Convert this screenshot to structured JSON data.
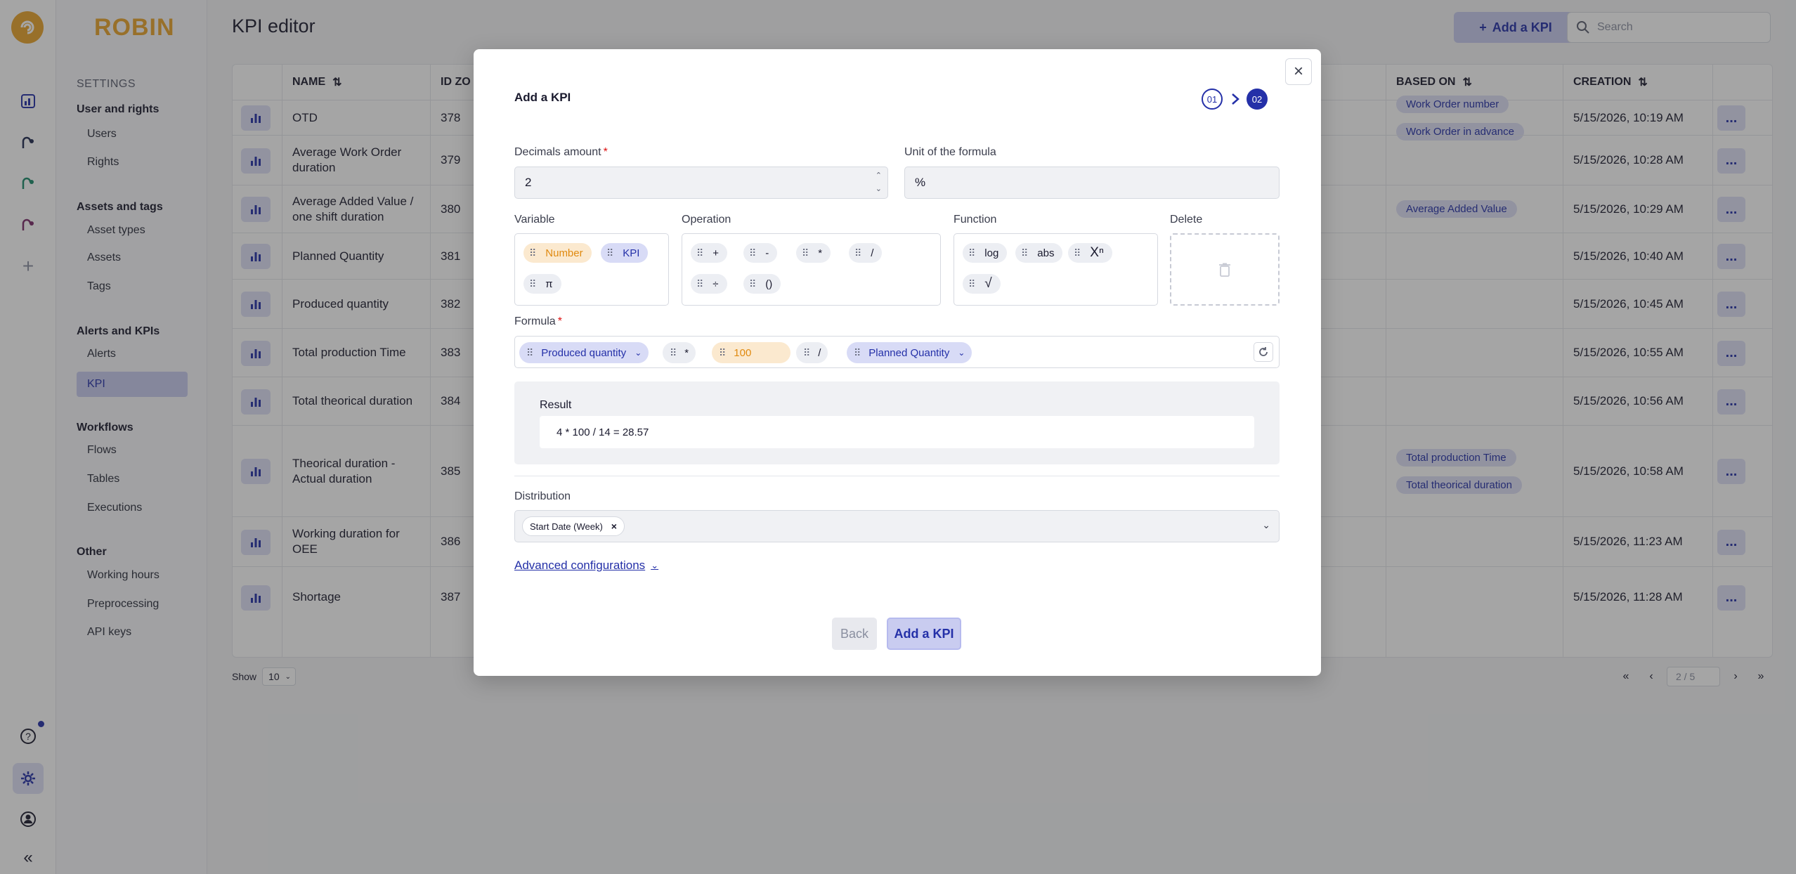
{
  "brand": {
    "name": "ROBIN"
  },
  "rail": {
    "notification_color": "#2430a8"
  },
  "sidebar": {
    "title": "SETTINGS",
    "groups": [
      {
        "label": "User and rights",
        "items": [
          "Users",
          "Rights"
        ]
      },
      {
        "label": "Assets and tags",
        "items": [
          "Asset types",
          "Assets",
          "Tags"
        ]
      },
      {
        "label": "Alerts and KPIs",
        "items": [
          "Alerts",
          "KPI"
        ]
      },
      {
        "label": "Workflows",
        "items": [
          "Flows",
          "Tables",
          "Executions"
        ]
      },
      {
        "label": "Other",
        "items": [
          "Working hours",
          "Preprocessing",
          "API keys"
        ]
      }
    ],
    "active_item": "KPI"
  },
  "header": {
    "title": "KPI editor",
    "add_label": "Add a KPI",
    "search_placeholder": "Search"
  },
  "table": {
    "columns": {
      "name": "NAME",
      "id": "ID ZO",
      "based_on": "BASED ON",
      "creation": "CREATION"
    },
    "rows": [
      {
        "name": "OTD",
        "id": "378",
        "based_on": [
          "Work Order number",
          "Work Order in advance"
        ],
        "creation": "5/15/2026, 10:19 AM"
      },
      {
        "name": "Average Work Order duration",
        "id": "379",
        "based_on": [],
        "creation": "5/15/2026, 10:28 AM"
      },
      {
        "name": "Average Added Value / one shift duration",
        "id": "380",
        "based_on": [
          "Average Added Value"
        ],
        "creation": "5/15/2026, 10:29 AM"
      },
      {
        "name": "Planned Quantity",
        "id": "381",
        "based_on": [],
        "creation": "5/15/2026, 10:40 AM"
      },
      {
        "name": "Produced quantity",
        "id": "382",
        "based_on": [],
        "creation": "5/15/2026, 10:45 AM"
      },
      {
        "name": "Total production Time",
        "id": "383",
        "based_on": [],
        "creation": "5/15/2026, 10:55 AM"
      },
      {
        "name": "Total theorical duration",
        "id": "384",
        "based_on": [],
        "creation": "5/15/2026, 10:56 AM"
      },
      {
        "name": "Theorical duration - Actual duration",
        "id": "385",
        "based_on": [
          "Total production Time",
          "Total theorical duration"
        ],
        "creation": "5/15/2026, 10:58 AM"
      },
      {
        "name": "Working duration for OEE",
        "id": "386",
        "based_on": [],
        "creation": "5/15/2026, 11:23 AM"
      },
      {
        "name": "Shortage",
        "id": "387",
        "based_on": [],
        "creation": "5/15/2026, 11:28 AM"
      }
    ],
    "more_label": "..."
  },
  "footer": {
    "show_label": "Show",
    "page_size": "10",
    "page_indicator": "2 / 5"
  },
  "modal": {
    "title": "Add a KPI",
    "steps": [
      "01",
      "02"
    ],
    "active_step": "02",
    "decimals": {
      "label": "Decimals amount",
      "value": "2"
    },
    "unit": {
      "label": "Unit of the formula",
      "value": "%"
    },
    "variable": {
      "label": "Variable",
      "chips": [
        "Number",
        "KPI",
        "π"
      ]
    },
    "operation": {
      "label": "Operation",
      "chips": [
        "+",
        "-",
        "*",
        "/",
        "÷",
        "()"
      ]
    },
    "function": {
      "label": "Function",
      "chips": [
        "log",
        "abs",
        "Xⁿ",
        "√"
      ]
    },
    "delete": {
      "label": "Delete"
    },
    "formula": {
      "label": "Formula",
      "tokens": [
        {
          "text": "Produced quantity",
          "kind": "kpi"
        },
        {
          "text": "*",
          "kind": "op"
        },
        {
          "text": "100",
          "kind": "number"
        },
        {
          "text": "/",
          "kind": "op"
        },
        {
          "text": "Planned Quantity",
          "kind": "kpi"
        }
      ]
    },
    "result": {
      "label": "Result",
      "value": "4 * 100 / 14 = 28.57"
    },
    "distribution": {
      "label": "Distribution",
      "chip": "Start Date (Week)"
    },
    "advanced_label": "Advanced configurations",
    "back_label": "Back",
    "submit_label": "Add a KPI"
  }
}
